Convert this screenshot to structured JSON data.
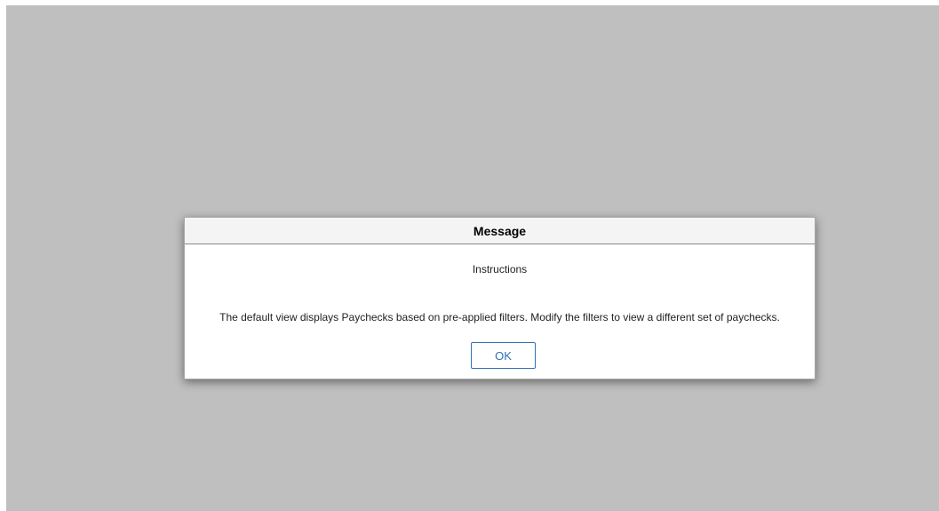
{
  "dialog": {
    "title": "Message",
    "subtitle": "Instructions",
    "message": "The default view displays Paychecks based on pre-applied filters. Modify the filters to view a different set of paychecks.",
    "ok_label": "OK"
  },
  "colors": {
    "overlay": "#bfbfbf",
    "accent": "#2f6fba",
    "header_bg": "#f4f4f4"
  }
}
